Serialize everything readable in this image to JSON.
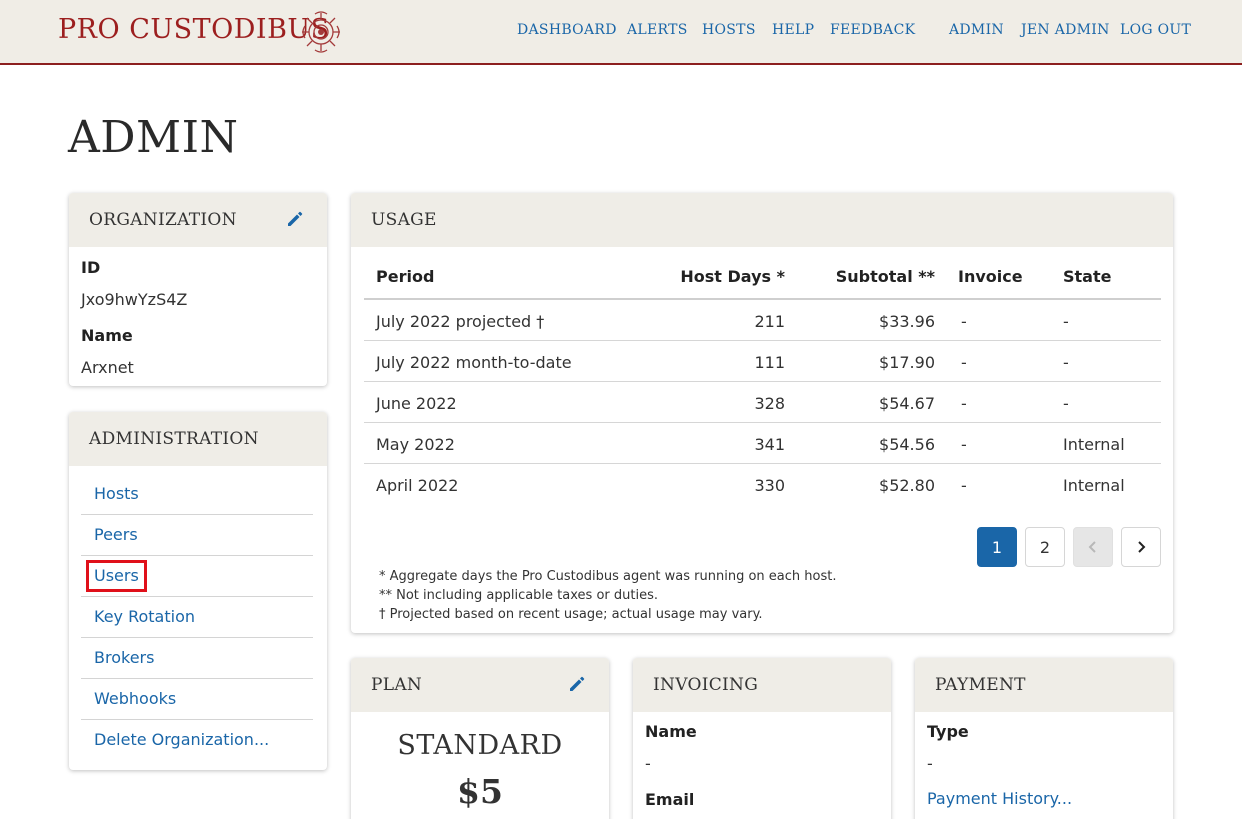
{
  "nav": {
    "brand": "PRO CUSTODIBUS",
    "links": [
      "DASHBOARD",
      "ALERTS",
      "HOSTS",
      "HELP",
      "FEEDBACK",
      "ADMIN",
      "JEN ADMIN",
      "LOG OUT"
    ]
  },
  "page": {
    "title": "ADMIN"
  },
  "organization": {
    "title": "ORGANIZATION",
    "id_label": "ID",
    "id_value": "Jxo9hwYzS4Z",
    "name_label": "Name",
    "name_value": "Arxnet"
  },
  "administration": {
    "title": "ADMINISTRATION",
    "links": [
      "Hosts",
      "Peers",
      "Users",
      "Key Rotation",
      "Brokers",
      "Webhooks",
      "Delete Organization..."
    ]
  },
  "usage": {
    "title": "USAGE",
    "columns": [
      "Period",
      "Host Days *",
      "Subtotal **",
      "Invoice",
      "State"
    ],
    "rows": [
      [
        "July 2022 projected †",
        "211",
        "$33.96",
        "-",
        "-"
      ],
      [
        "July 2022 month-to-date",
        "111",
        "$17.90",
        "-",
        "-"
      ],
      [
        "June 2022",
        "328",
        "$54.67",
        "-",
        "-"
      ],
      [
        "May 2022",
        "341",
        "$54.56",
        "-",
        "Internal"
      ],
      [
        "April 2022",
        "330",
        "$52.80",
        "-",
        "Internal"
      ]
    ],
    "pages": [
      "1",
      "2"
    ],
    "current_page": "1",
    "footnotes": [
      "* Aggregate days the Pro Custodibus agent was running on each host.",
      "** Not including applicable taxes or duties.",
      "† Projected based on recent usage; actual usage may vary."
    ]
  },
  "plan": {
    "title": "PLAN",
    "name": "STANDARD",
    "price": "$5"
  },
  "invoicing": {
    "title": "INVOICING",
    "name_label": "Name",
    "name_value": "-",
    "email_label": "Email"
  },
  "payment": {
    "title": "PAYMENT",
    "type_label": "Type",
    "type_value": "-",
    "history_link": "Payment History..."
  },
  "colors": {
    "accent": "#1a66a8",
    "brand": "#9c1f1f",
    "highlight": "#e0101a",
    "header_bg": "#efede7"
  },
  "icons": [
    "brand-logo-icon",
    "pencil-icon",
    "chevron-left-icon",
    "chevron-right-icon"
  ]
}
